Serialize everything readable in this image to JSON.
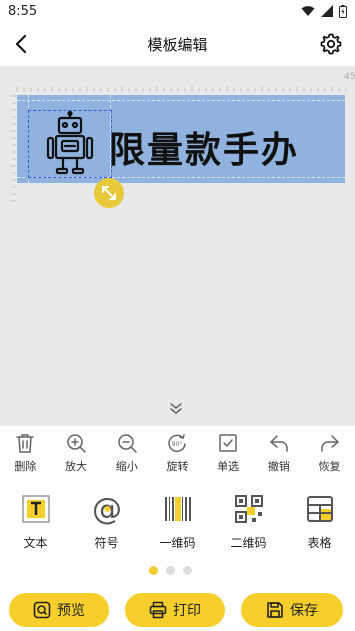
{
  "status": {
    "time": "8:55"
  },
  "header": {
    "title": "模板编辑"
  },
  "canvas": {
    "ruler_label": "45",
    "label_text": "限量款手办"
  },
  "toolbar": {
    "delete": "删除",
    "zoom_in": "放大",
    "zoom_out": "缩小",
    "rotate": "旋转",
    "rotate_badge": "90°",
    "select": "单选",
    "undo": "撤销",
    "redo": "恢复"
  },
  "elements": {
    "text": "文本",
    "symbol": "符号",
    "barcode": "一维码",
    "qrcode": "二维码",
    "table": "表格"
  },
  "actions": {
    "preview": "预览",
    "print": "打印",
    "save": "保存"
  },
  "colors": {
    "accent": "#f6cf2d",
    "label_bg": "#8fb2de",
    "canvas_bg": "#e9e9ea"
  }
}
